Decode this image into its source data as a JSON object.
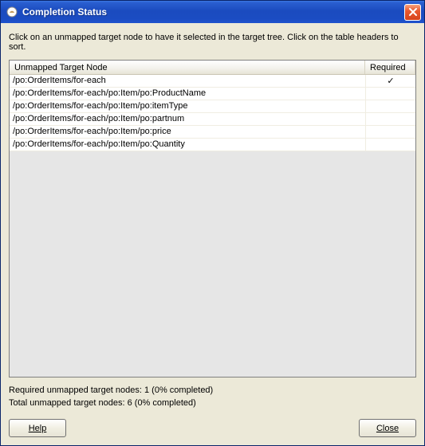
{
  "title": "Completion Status",
  "instruction": "Click on an unmapped target node to have it selected in the target tree. Click on the table headers to sort.",
  "columns": {
    "node": "Unmapped Target Node",
    "required": "Required"
  },
  "rows": [
    {
      "path": "/po:OrderItems/for-each",
      "required": true
    },
    {
      "path": "/po:OrderItems/for-each/po:Item/po:ProductName",
      "required": false
    },
    {
      "path": "/po:OrderItems/for-each/po:Item/po:itemType",
      "required": false
    },
    {
      "path": "/po:OrderItems/for-each/po:Item/po:partnum",
      "required": false
    },
    {
      "path": "/po:OrderItems/for-each/po:Item/po:price",
      "required": false
    },
    {
      "path": "/po:OrderItems/for-each/po:Item/po:Quantity",
      "required": false
    }
  ],
  "stats": {
    "required_line": "Required unmapped target nodes: 1 (0% completed)",
    "total_line": "Total unmapped target nodes: 6 (0% completed)"
  },
  "buttons": {
    "help": "Help",
    "close": "Close"
  },
  "checkmark": "✓"
}
